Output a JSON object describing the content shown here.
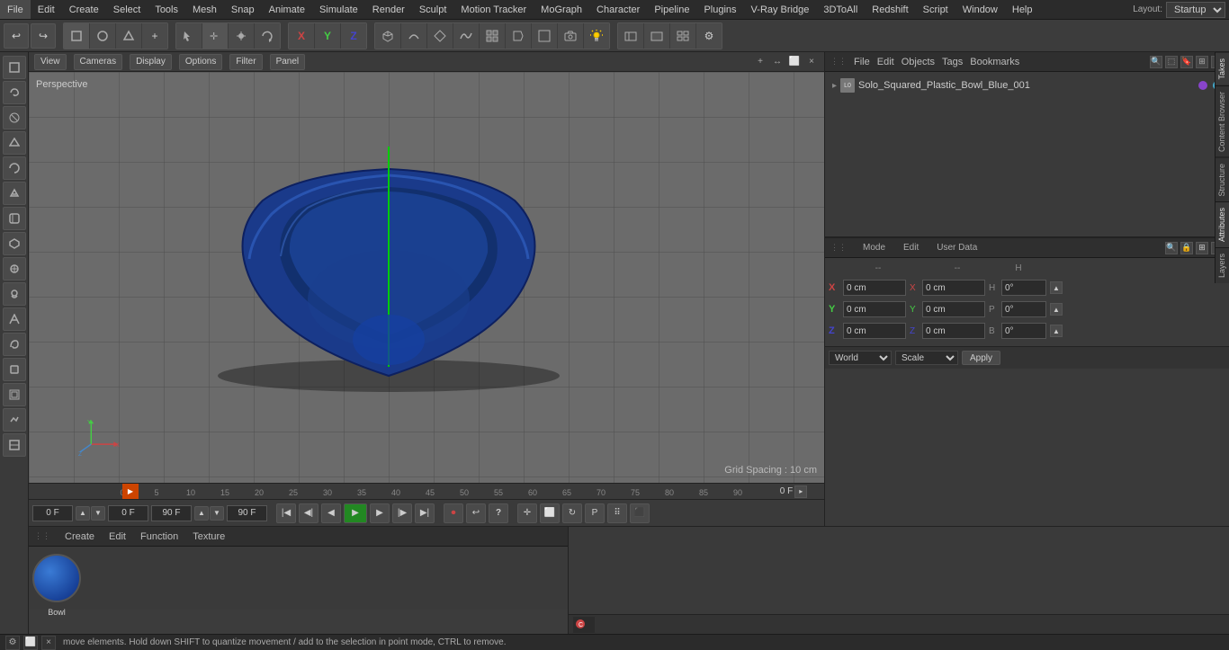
{
  "app": {
    "title": "Cinema 4D",
    "layout": "Startup"
  },
  "top_menu": {
    "items": [
      "File",
      "Edit",
      "Create",
      "Select",
      "Tools",
      "Mesh",
      "Snap",
      "Animate",
      "Simulate",
      "Render",
      "Sculpt",
      "Motion Tracker",
      "MoGraph",
      "Character",
      "Pipeline",
      "Plugins",
      "V-Ray Bridge",
      "3DToAll",
      "Redshift",
      "Script",
      "Window",
      "Help",
      "Layout:"
    ]
  },
  "toolbar": {
    "undo_label": "↩",
    "redo_label": "↪",
    "move_label": "↖",
    "scale_label": "⊕",
    "rotate_label": "↻",
    "translate_label": "+",
    "x_label": "X",
    "y_label": "Y",
    "z_label": "Z",
    "obj_mode": "□",
    "pen_label": "✎",
    "scene_label": "⬡",
    "deform_label": "◈",
    "array_label": "⊞",
    "tag_label": "◇",
    "paint_label": "◻",
    "cam_label": "📷",
    "light_label": "💡"
  },
  "viewport": {
    "label": "Perspective",
    "header_menus": [
      "View",
      "Cameras",
      "Display",
      "Options",
      "Filter",
      "Panel"
    ],
    "grid_spacing": "Grid Spacing : 10 cm",
    "perspective_label": "Perspective"
  },
  "timeline": {
    "frame_start": "0 F",
    "frame_current": "0 F",
    "frame_end": "90 F",
    "frame_end2": "90 F",
    "ticks": [
      "0",
      "5",
      "10",
      "15",
      "20",
      "25",
      "30",
      "35",
      "40",
      "45",
      "50",
      "55",
      "60",
      "65",
      "70",
      "75",
      "80",
      "85",
      "90"
    ]
  },
  "objects_panel": {
    "header_menus": [
      "File",
      "Edit",
      "Objects",
      "Tags",
      "Bookmarks"
    ],
    "object": {
      "name": "Solo_Squared_Plastic_Bowl_Blue_001",
      "type": "L0",
      "dot1_color": "#8844cc",
      "dot2_color": "#44aacc"
    }
  },
  "attributes_panel": {
    "tabs": [
      "Mode",
      "Edit",
      "User Data"
    ],
    "fields": {
      "x_pos": "0 cm",
      "y_pos": "0 cm",
      "z_pos": "0 cm",
      "x_rot": "0 cm",
      "y_rot": "0 cm",
      "z_rot": "0 cm",
      "p_val": "0°",
      "b_val": "0°",
      "h_val": "0°"
    }
  },
  "coord_bar": {
    "x_label": "X",
    "y_label": "Y",
    "z_label": "Z",
    "x_val": "0 cm",
    "y_val": "0 cm",
    "z_val": "0 cm",
    "x2_label": "X",
    "y2_label": "Y",
    "z2_label": "Z",
    "x2_val": "0 cm",
    "y2_val": "0 cm",
    "z2_val": "0 cm",
    "h_label": "H",
    "p_label": "P",
    "b_label": "B",
    "h_val": "0°",
    "p_val": "0°",
    "b_val": "0°",
    "world_label": "World",
    "scale_label": "Scale",
    "apply_label": "Apply",
    "dashes1": "--",
    "dashes2": "--"
  },
  "mat_panel": {
    "menus": [
      "Create",
      "Edit",
      "Function",
      "Texture"
    ],
    "material_name": "Bowl"
  },
  "status_bar": {
    "text": "move elements. Hold down SHIFT to quantize movement / add to the selection in point mode, CTRL to remove."
  },
  "side_tabs": [
    "Takes",
    "Content Browser",
    "Structure",
    "Attributes",
    "Layers"
  ]
}
